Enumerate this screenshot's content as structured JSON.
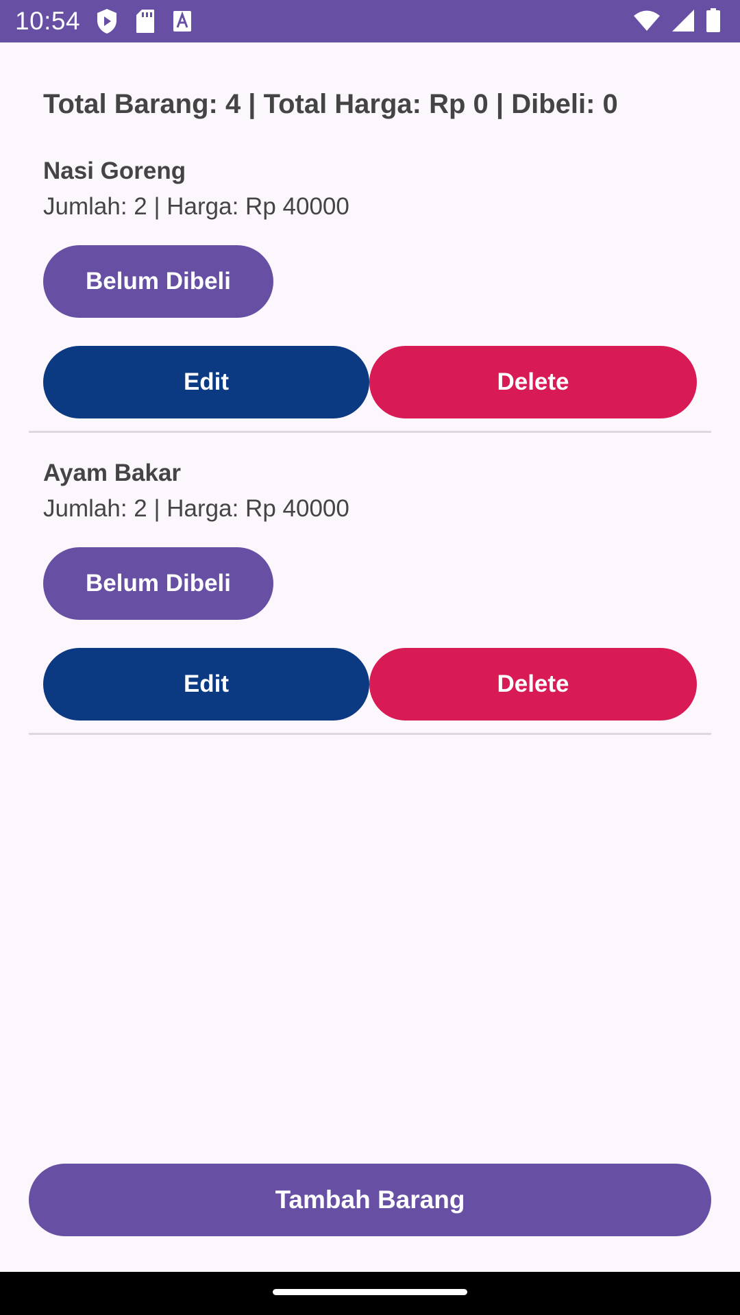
{
  "status_bar": {
    "time": "10:54",
    "left_icons": [
      "play-protect-icon",
      "sd-card-icon",
      "font-a-icon"
    ],
    "right_icons": [
      "wifi-icon",
      "cell-signal-icon",
      "battery-icon"
    ]
  },
  "summary": {
    "text": "Total Barang: 4 | Total Harga: Rp 0 | Dibeli: 0"
  },
  "items": [
    {
      "name": "Nasi Goreng",
      "details": "Jumlah: 2 | Harga: Rp 40000",
      "status_label": "Belum Dibeli",
      "edit_label": "Edit",
      "delete_label": "Delete"
    },
    {
      "name": "Ayam Bakar",
      "details": "Jumlah: 2 | Harga: Rp 40000",
      "status_label": "Belum Dibeli",
      "edit_label": "Edit",
      "delete_label": "Delete"
    }
  ],
  "add_button": {
    "label": "Tambah Barang"
  },
  "colors": {
    "primary": "#6750A4",
    "edit": "#0B3A82",
    "delete": "#D81A55",
    "background": "#FCF6FD"
  }
}
